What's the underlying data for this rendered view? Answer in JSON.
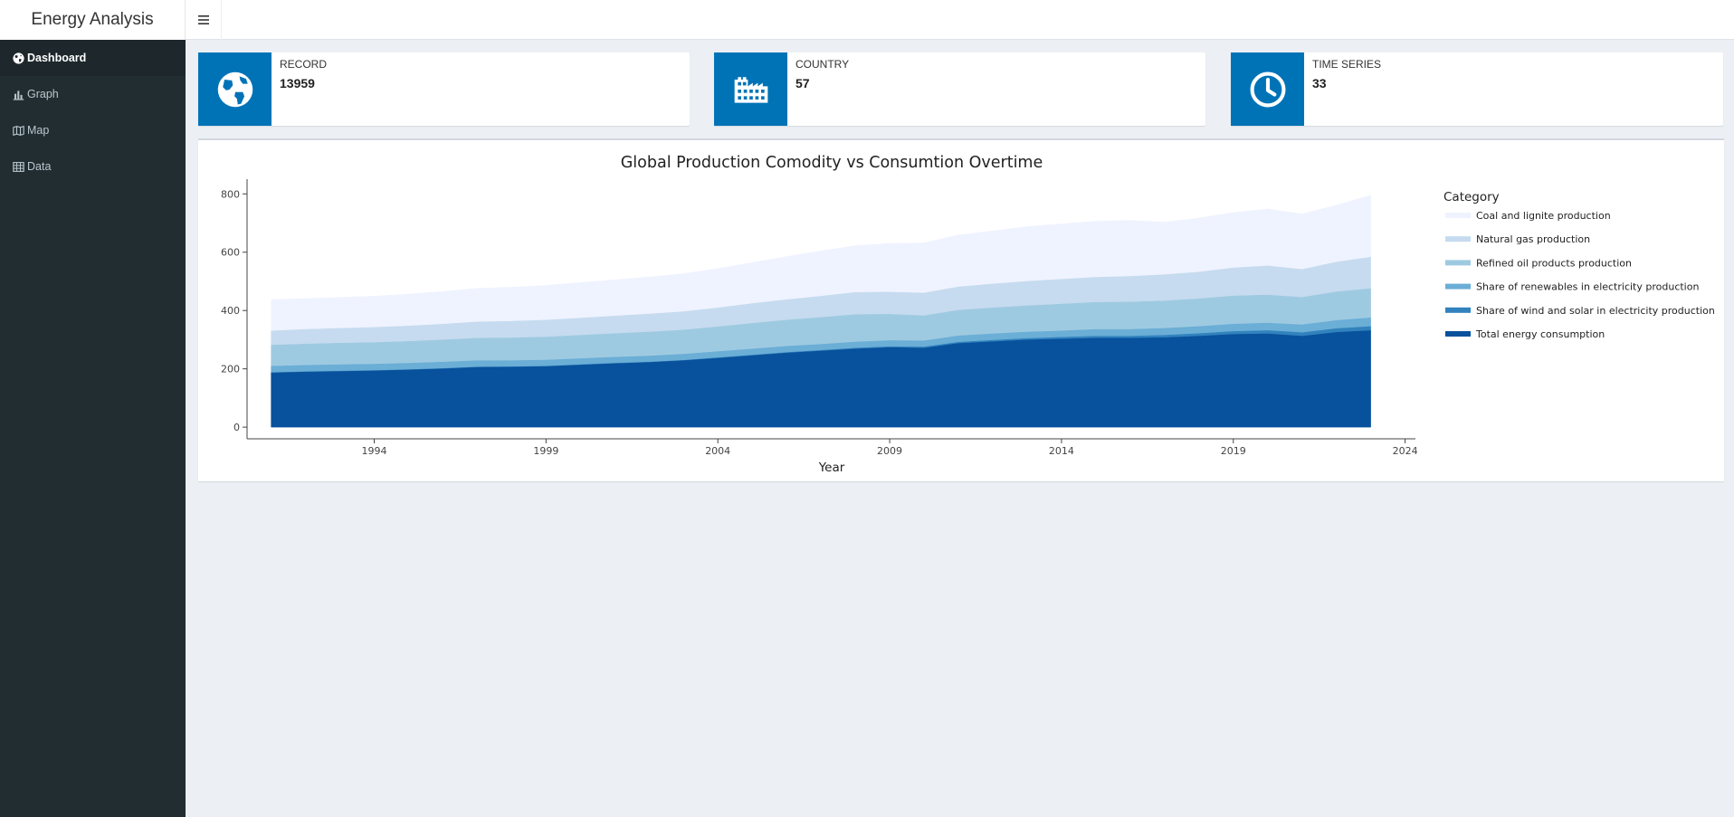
{
  "app": {
    "title": "Energy Analysis",
    "toggle_icon": "hamburger-icon"
  },
  "sidebar": {
    "items": [
      {
        "label": "Dashboard",
        "icon": "globe-icon",
        "active": true
      },
      {
        "label": "Graph",
        "icon": "bar-chart-icon",
        "active": false
      },
      {
        "label": "Map",
        "icon": "map-icon",
        "active": false
      },
      {
        "label": "Data",
        "icon": "table-icon",
        "active": false
      }
    ]
  },
  "info_boxes": [
    {
      "label": "RECORD",
      "value": "13959",
      "icon": "globe-icon"
    },
    {
      "label": "COUNTRY",
      "value": "57",
      "icon": "industry-icon"
    },
    {
      "label": "TIME SERIES",
      "value": "33",
      "icon": "clock-icon"
    }
  ],
  "colors": {
    "accent": "#0073b7",
    "sidebar_bg": "#222d32",
    "page_bg": "#ecf0f5"
  },
  "chart_data": {
    "type": "area",
    "stacked": true,
    "title": "Global Production Comodity vs Consumtion Overtime",
    "xlabel": "Year",
    "ylabel": "",
    "xlim": [
      1990.3,
      2024.3
    ],
    "ylim": [
      -40,
      835
    ],
    "x_ticks": [
      1994,
      1999,
      2004,
      2009,
      2014,
      2019,
      2024
    ],
    "y_ticks": [
      0,
      200,
      400,
      600,
      800
    ],
    "grid": false,
    "legend": {
      "title": "Category",
      "position": "right"
    },
    "x": [
      1991,
      1992,
      1993,
      1994,
      1995,
      1996,
      1997,
      1998,
      1999,
      2000,
      2001,
      2002,
      2003,
      2004,
      2005,
      2006,
      2007,
      2008,
      2009,
      2010,
      2011,
      2012,
      2013,
      2014,
      2015,
      2016,
      2017,
      2018,
      2019,
      2020,
      2021,
      2022,
      2023
    ],
    "series": [
      {
        "name": "Total energy consumption",
        "color": "#08519c",
        "values": [
          186,
          189,
          191,
          193,
          196,
          200,
          205,
          206,
          208,
          213,
          218,
          222,
          228,
          236,
          245,
          254,
          261,
          268,
          273,
          271,
          287,
          293,
          299,
          302,
          305,
          305,
          307,
          312,
          318,
          320,
          312,
          325,
          331
        ]
      },
      {
        "name": "Share of wind and solar in electricity production",
        "color": "#3182bd",
        "values": [
          1,
          1,
          1,
          1,
          1,
          1,
          1,
          1,
          1,
          1,
          1,
          1,
          1,
          2,
          2,
          2,
          2,
          3,
          3,
          4,
          4,
          5,
          5,
          6,
          7,
          7,
          8,
          9,
          10,
          11,
          12,
          13,
          14
        ]
      },
      {
        "name": "Share of renewables in electricity production",
        "color": "#6baed6",
        "values": [
          22,
          22,
          22,
          22,
          22,
          22,
          22,
          21,
          21,
          21,
          21,
          21,
          21,
          21,
          21,
          21,
          21,
          21,
          21,
          21,
          22,
          22,
          22,
          22,
          23,
          23,
          24,
          24,
          25,
          26,
          27,
          28,
          30
        ]
      },
      {
        "name": "Refined oil products production",
        "color": "#9ecae1",
        "values": [
          72,
          73,
          74,
          74,
          75,
          76,
          77,
          78,
          79,
          80,
          81,
          82,
          83,
          85,
          88,
          90,
          92,
          94,
          90,
          86,
          88,
          89,
          90,
          92,
          93,
          94,
          94,
          95,
          97,
          96,
          94,
          98,
          100
        ]
      },
      {
        "name": "Natural gas production",
        "color": "#c6dbef",
        "values": [
          49,
          50,
          51,
          52,
          53,
          54,
          56,
          57,
          58,
          59,
          60,
          62,
          63,
          65,
          68,
          70,
          73,
          76,
          76,
          78,
          80,
          82,
          84,
          85,
          86,
          88,
          90,
          92,
          96,
          100,
          96,
          102,
          108
        ]
      },
      {
        "name": "Coal and lignite production",
        "color": "#eff3ff",
        "values": [
          107,
          106,
          106,
          107,
          109,
          112,
          115,
          117,
          119,
          122,
          124,
          127,
          130,
          135,
          140,
          148,
          155,
          160,
          167,
          172,
          178,
          182,
          188,
          190,
          192,
          192,
          180,
          185,
          190,
          195,
          190,
          195,
          212
        ]
      }
    ]
  }
}
